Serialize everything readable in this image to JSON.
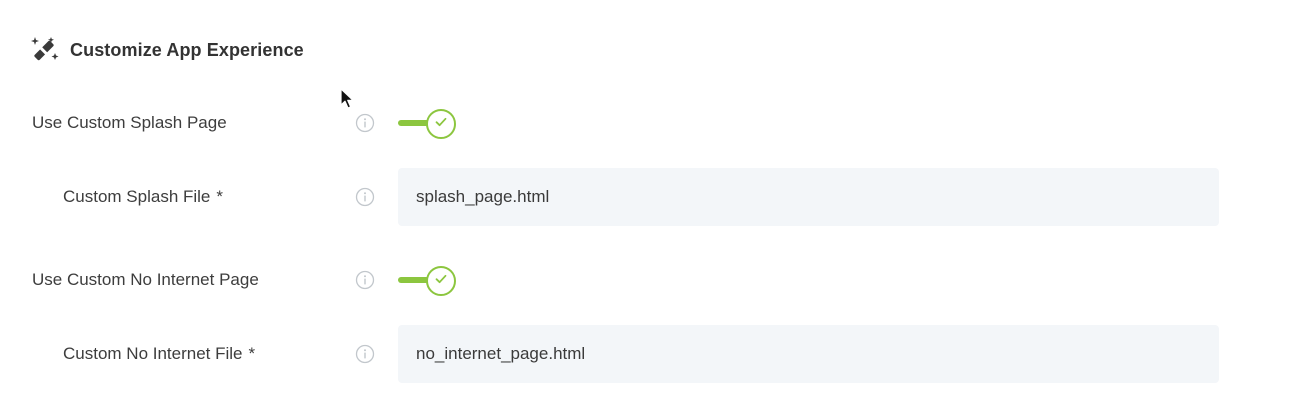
{
  "section": {
    "title": "Customize App Experience",
    "icon": "magic-wand-icon"
  },
  "rows": [
    {
      "label": "Use Custom Splash Page",
      "type": "toggle",
      "enabled": true
    },
    {
      "label": "Custom Splash File",
      "required_mark": "*",
      "type": "text",
      "value": "splash_page.html"
    },
    {
      "label": "Use Custom No Internet Page",
      "type": "toggle",
      "enabled": true
    },
    {
      "label": "Custom No Internet File",
      "required_mark": "*",
      "type": "text",
      "value": "no_internet_page.html"
    }
  ],
  "colors": {
    "toggle_on": "#8cc63f",
    "field_bg": "#f3f6f9",
    "info_icon": "#c2c7cc"
  }
}
